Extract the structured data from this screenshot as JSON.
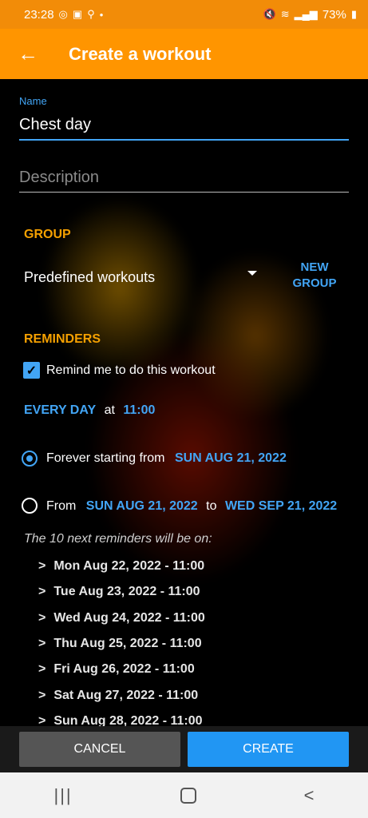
{
  "status": {
    "time": "23:28",
    "left_icons": [
      "instagram-icon",
      "image-icon",
      "search-icon",
      "dot"
    ],
    "right_icons": [
      "mute-icon",
      "wifi-icon",
      "signal-icon"
    ],
    "battery": "73%"
  },
  "appbar": {
    "title": "Create a workout"
  },
  "form": {
    "name_label": "Name",
    "name_value": "Chest day",
    "description_placeholder": "Description"
  },
  "group": {
    "section_title": "GROUP",
    "selected": "Predefined workouts",
    "new_group_line1": "NEW",
    "new_group_line2": "GROUP"
  },
  "reminders": {
    "section_title": "REMINDERS",
    "checkbox_label": "Remind me to do this workout",
    "checked": true,
    "frequency": "EVERY DAY",
    "at": "at",
    "time": "11:00",
    "option1_label": "Forever starting from",
    "option1_date": "SUN AUG 21, 2022",
    "option2_label": "From",
    "option2_start": "SUN AUG 21, 2022",
    "option2_to": "to",
    "option2_end": "WED SEP 21, 2022",
    "next_title": "The 10 next reminders will be on:",
    "next": [
      "Mon Aug 22, 2022 - 11:00",
      "Tue Aug 23, 2022 - 11:00",
      "Wed Aug 24, 2022 - 11:00",
      "Thu Aug 25, 2022 - 11:00",
      "Fri Aug 26, 2022 - 11:00",
      "Sat Aug 27, 2022 - 11:00",
      "Sun Aug 28, 2022 - 11:00"
    ]
  },
  "actions": {
    "cancel": "CANCEL",
    "create": "CREATE"
  },
  "colors": {
    "accent": "#ff9500",
    "link": "#42a5f5",
    "primary_button": "#2196f3"
  }
}
